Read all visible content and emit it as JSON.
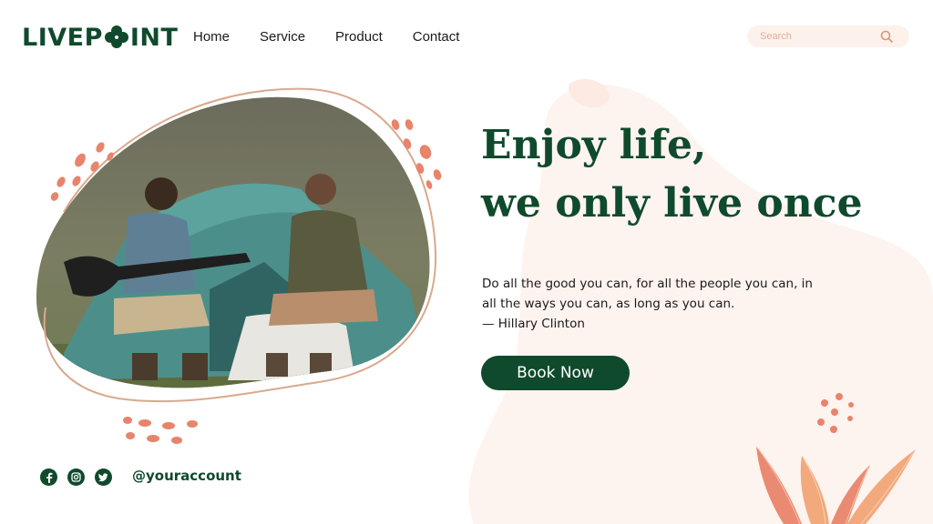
{
  "brand": {
    "logo_left": "LIVEP",
    "logo_right": "INT",
    "color": "#0f4a2c",
    "accent": "#e8846b"
  },
  "nav": {
    "items": [
      {
        "label": "Home"
      },
      {
        "label": "Service"
      },
      {
        "label": "Product"
      },
      {
        "label": "Contact"
      }
    ]
  },
  "search": {
    "placeholder": "Search",
    "icon": "search-icon"
  },
  "hero": {
    "headline_line1": "Enjoy life,",
    "headline_line2": "we only live once",
    "quote_line1": "Do all the good you can, for all the people you can, in",
    "quote_line2": "all the ways you can, as long as you can.",
    "quote_author": "— Hillary Clinton",
    "cta_label": "Book Now"
  },
  "social": {
    "icons": [
      "facebook-icon",
      "instagram-icon",
      "twitter-icon"
    ],
    "handle": "@youraccount"
  }
}
